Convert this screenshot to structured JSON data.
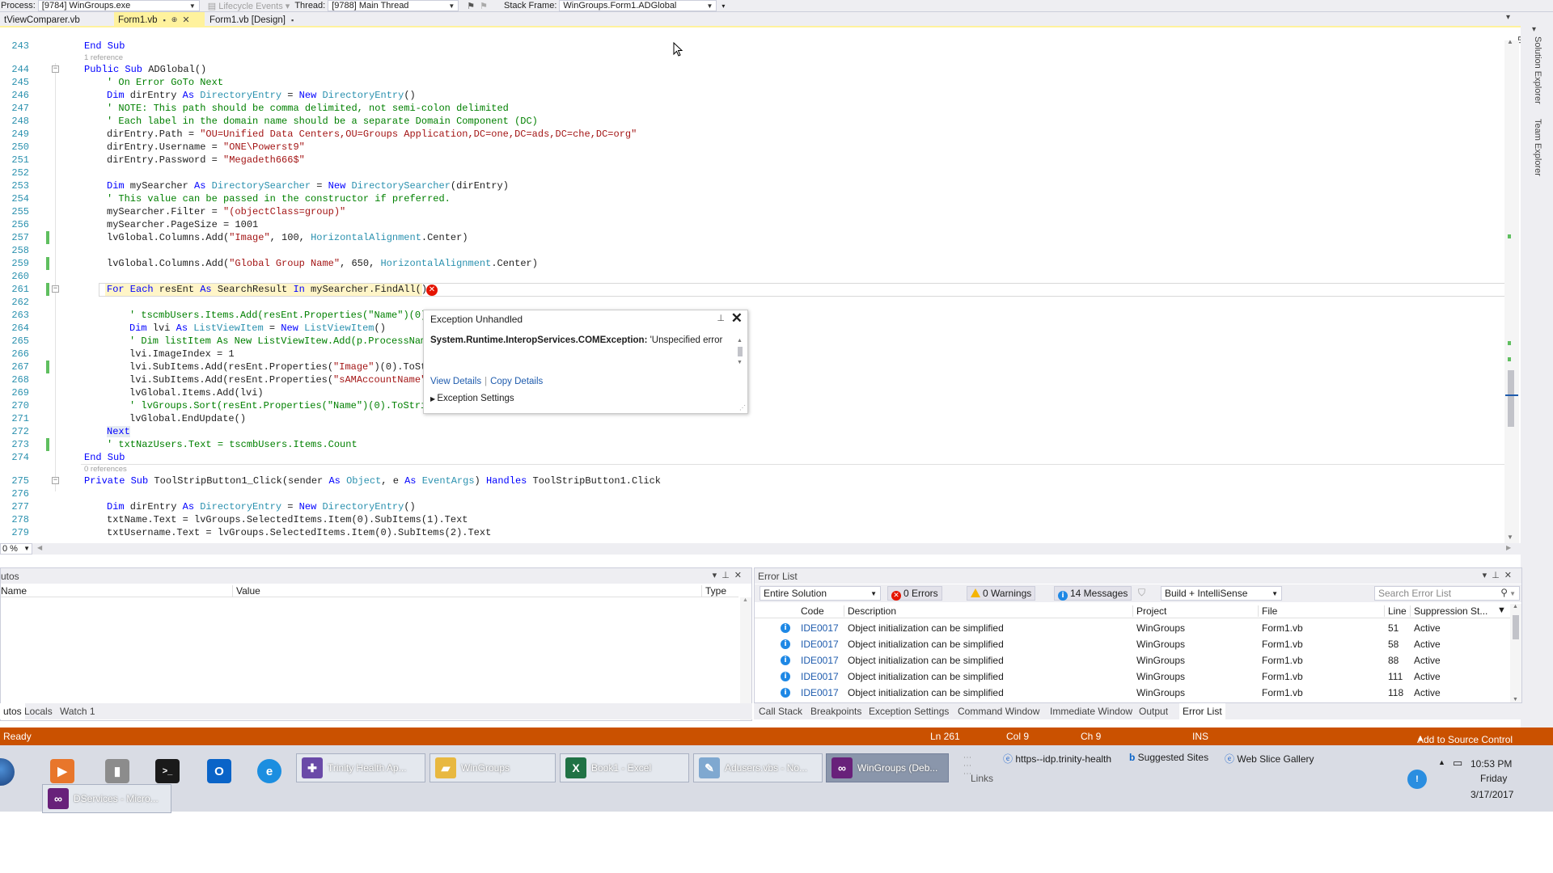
{
  "debug_toolbar": {
    "process_label": "Process:",
    "process_value": "[9784] WinGroups.exe",
    "lifecycle_label": "Lifecycle Events",
    "thread_label": "Thread:",
    "thread_value": "[9788] Main Thread",
    "stack_frame_label": "Stack Frame:",
    "stack_frame_value": "WinGroups.Form1.ADGlobal"
  },
  "doc_tabs": [
    {
      "label": "tViewComparer.vb"
    },
    {
      "label": "Form1.vb"
    },
    {
      "label": "Form1.vb [Design]"
    }
  ],
  "editor": {
    "refs": {
      "one": "1 reference",
      "zero": "0 references"
    },
    "lines": {
      "l243": "243",
      "l244": "244",
      "l245": "245",
      "l246": "246",
      "l247": "247",
      "l248": "248",
      "l249": "249",
      "l250": "250",
      "l251": "251",
      "l252": "252",
      "l253": "253",
      "l254": "254",
      "l255": "255",
      "l256": "256",
      "l257": "257",
      "l258": "258",
      "l259": "259",
      "l260": "260",
      "l261": "261",
      "l262": "262",
      "l263": "263",
      "l264": "264",
      "l265": "265",
      "l266": "266",
      "l267": "267",
      "l268": "268",
      "l269": "269",
      "l270": "270",
      "l271": "271",
      "l272": "272",
      "l273": "273",
      "l274": "274",
      "l275": "275",
      "l276": "276",
      "l277": "277",
      "l278": "278",
      "l279": "279"
    },
    "code": {
      "c243": "End Sub",
      "c244a": "Public Sub",
      "c244b": " ADGlobal()",
      "c245": "' On Error GoTo Next",
      "c246a": "Dim",
      "c246b": " dirEntry ",
      "c246c": "As",
      "c246d": " ",
      "c246e": "DirectoryEntry",
      "c246f": " = ",
      "c246g": "New",
      "c246h": " ",
      "c246i": "DirectoryEntry",
      "c246j": "()",
      "c247": "' NOTE: This path should be comma delimited, not semi-colon delimited",
      "c248": "' Each label in the domain name should be a separate Domain Component (DC)",
      "c249a": "dirEntry.Path = ",
      "c249b": "\"OU=Unified Data Centers,OU=Groups Application,DC=one,DC=ads,DC=che,DC=org\"",
      "c250a": "dirEntry.Username = ",
      "c250b": "\"ONE\\Powerst9\"",
      "c251a": "dirEntry.Password = ",
      "c251b": "\"Megadeth666$\"",
      "c253a": "Dim",
      "c253b": " mySearcher ",
      "c253c": "As",
      "c253d": " ",
      "c253e": "DirectorySearcher",
      "c253f": " = ",
      "c253g": "New",
      "c253h": " ",
      "c253i": "DirectorySearcher",
      "c253j": "(dirEntry)",
      "c254": "' This value can be passed in the constructor if preferred.",
      "c255a": "mySearcher.Filter = ",
      "c255b": "\"(objectClass=group)\"",
      "c256": "mySearcher.PageSize = 1001",
      "c257a": "lvGlobal.Columns.Add(",
      "c257b": "\"Image\"",
      "c257c": ", 100, ",
      "c257d": "HorizontalAlignment",
      "c257e": ".Center)",
      "c259a": "lvGlobal.Columns.Add(",
      "c259b": "\"Global Group Name\"",
      "c259c": ", 650, ",
      "c259d": "HorizontalAlignment",
      "c259e": ".Center)",
      "c261a": "For Each",
      "c261b": " resEnt ",
      "c261c": "As",
      "c261d": " SearchResult ",
      "c261e": "In",
      "c261f": " mySearcher.FindAll()",
      "c263": "' tscmbUsers.Items.Add(resEnt.Properties(\"Name\")(0)",
      "c264a": "Dim",
      "c264b": " lvi ",
      "c264c": "As",
      "c264d": " ",
      "c264e": "ListViewItem",
      "c264f": " = ",
      "c264g": "New",
      "c264h": " ",
      "c264i": "ListViewItem",
      "c264j": "()",
      "c265": "' Dim listItem As New ListViewItew.Add(p.ProcessNam",
      "c266": "lvi.ImageIndex = 1",
      "c267a": "lvi.SubItems.Add(resEnt.Properties(",
      "c267b": "\"Image\"",
      "c267c": ")(0).ToSt",
      "c268a": "lvi.SubItems.Add(resEnt.Properties(",
      "c268b": "\"sAMAccountName\"",
      "c269": "lvGlobal.Items.Add(lvi)",
      "c270": "' lvGroups.Sort(resEnt.Properties(\"Name\")(0).ToStri",
      "c271": "lvGlobal.EndUpdate()",
      "c272": "Next",
      "c273": "' txtNazUsers.Text = tscmbUsers.Items.Count",
      "c274": "End Sub",
      "c275a": "Private Sub",
      "c275b": " ToolStripButton1_Click(sender ",
      "c275c": "As",
      "c275d": " ",
      "c275e": "Object",
      "c275f": ", e ",
      "c275g": "As",
      "c275h": " ",
      "c275i": "EventArgs",
      "c275j": ") ",
      "c275k": "Handles",
      "c275l": " ToolStripButton1.Click",
      "c277a": "Dim",
      "c277b": " dirEntry ",
      "c277c": "As",
      "c277d": " ",
      "c277e": "DirectoryEntry",
      "c277f": " = ",
      "c277g": "New",
      "c277h": " ",
      "c277i": "DirectoryEntry",
      "c277j": "()",
      "c278": "txtName.Text = lvGroups.SelectedItems.Item(0).SubItems(1).Text",
      "c279": "txtUsername.Text = lvGroups.SelectedItems.Item(0).SubItems(2).Text"
    },
    "zoom": "0 %"
  },
  "exception": {
    "title": "Exception Unhandled",
    "type": "System.Runtime.InteropServices.COMException:",
    "message": " 'Unspecified error",
    "view_details": "View Details",
    "copy_details": "Copy Details",
    "settings": "Exception Settings"
  },
  "right_strip": {
    "solution_explorer": "Solution Explorer",
    "team_explorer": "Team Explorer"
  },
  "autos": {
    "title": "utos",
    "col_name": "Name",
    "col_value": "Value",
    "col_type": "Type",
    "tabs": [
      "utos",
      "Locals",
      "Watch 1"
    ]
  },
  "error_list": {
    "title": "Error List",
    "scope": "Entire Solution",
    "errors": "0 Errors",
    "warnings": "0 Warnings",
    "messages": "14 Messages",
    "build": "Build + IntelliSense",
    "search_placeholder": "Search Error List",
    "headers": {
      "code": "Code",
      "description": "Description",
      "project": "Project",
      "file": "File",
      "line": "Line",
      "suppression": "Suppression St..."
    },
    "rows": [
      {
        "code": "IDE0017",
        "description": "Object initialization can be simplified",
        "project": "WinGroups",
        "file": "Form1.vb",
        "line": "51",
        "state": "Active"
      },
      {
        "code": "IDE0017",
        "description": "Object initialization can be simplified",
        "project": "WinGroups",
        "file": "Form1.vb",
        "line": "58",
        "state": "Active"
      },
      {
        "code": "IDE0017",
        "description": "Object initialization can be simplified",
        "project": "WinGroups",
        "file": "Form1.vb",
        "line": "88",
        "state": "Active"
      },
      {
        "code": "IDE0017",
        "description": "Object initialization can be simplified",
        "project": "WinGroups",
        "file": "Form1.vb",
        "line": "111",
        "state": "Active"
      },
      {
        "code": "IDE0017",
        "description": "Object initialization can be simplified",
        "project": "WinGroups",
        "file": "Form1.vb",
        "line": "118",
        "state": "Active"
      }
    ],
    "tabs": [
      "Call Stack",
      "Breakpoints",
      "Exception Settings",
      "Command Window",
      "Immediate Window",
      "Output",
      "Error List"
    ]
  },
  "status": {
    "ready": "Ready",
    "ln": "Ln 261",
    "col": "Col 9",
    "ch": "Ch 9",
    "ins": "INS",
    "source_control": "Add to Source Control"
  },
  "taskbar": {
    "buttons": [
      {
        "label": "Trinity Health Ap..."
      },
      {
        "label": "WinGroups"
      },
      {
        "label": "Book1 - Excel"
      },
      {
        "label": "Adusers.vbs - No..."
      },
      {
        "label": "WinGroups (Deb..."
      },
      {
        "label": "DServices - Micro..."
      }
    ],
    "links": {
      "idp": "https--idp.trinity-health",
      "suggested": "Suggested Sites",
      "webslice": "Web Slice Gallery",
      "label": "Links"
    },
    "clock": {
      "time": "10:53 PM",
      "day": "Friday",
      "date": "3/17/2017"
    }
  },
  "colors": {
    "status_bar": "#ca5100",
    "active_tab": "#fff29d",
    "keyword": "#0000ff",
    "type": "#2b91af",
    "string": "#a31515",
    "comment": "#008000"
  }
}
